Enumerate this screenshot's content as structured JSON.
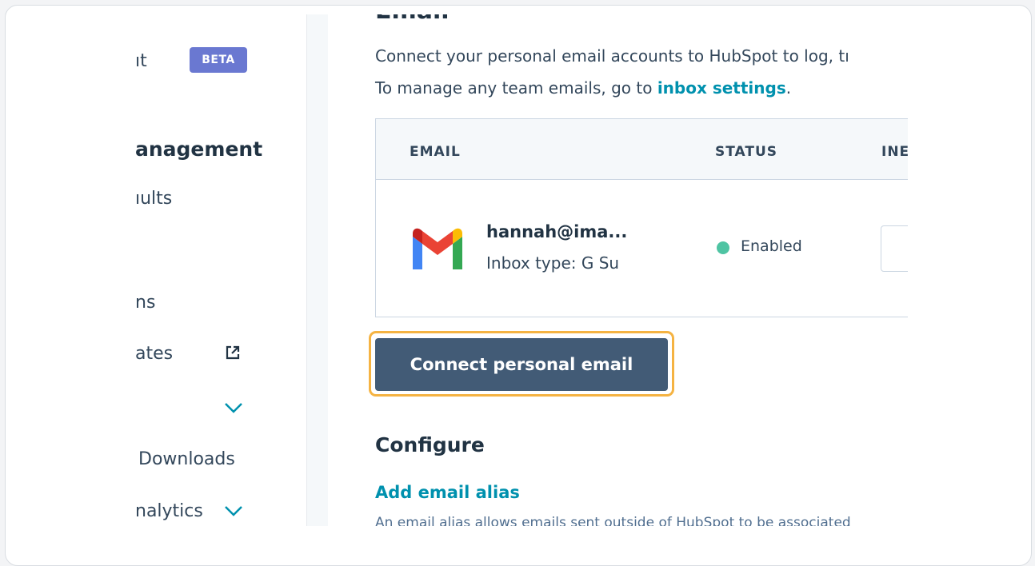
{
  "sidebar": {
    "items": [
      {
        "label": "ıt"
      },
      {
        "label": "anagement"
      },
      {
        "label": "ıults"
      },
      {
        "label": "ns"
      },
      {
        "label": "ates"
      },
      {
        "label": "Downloads"
      },
      {
        "label": "nalytics"
      }
    ],
    "beta_badge": "BETA"
  },
  "main": {
    "heading": "Email",
    "intro_line1": "Connect your personal email accounts to HubSpot to log, tı",
    "intro_line2_prefix": "To manage any team emails, go to ",
    "intro_link": "inbox settings",
    "intro_line2_suffix": ".",
    "table": {
      "columns": [
        "EMAIL",
        "STATUS",
        "INE"
      ],
      "row": {
        "email": "hannah@ima...",
        "inbox_type": "Inbox type: G Su",
        "status": "Enabled"
      }
    },
    "connect_button": "Connect personal email",
    "configure_heading": "Configure",
    "alias_link": "Add email alias",
    "alias_description": "An email alias allows emails sent outside of HubSpot to be associated"
  },
  "colors": {
    "accent": "#0091ae",
    "button": "#425b76",
    "focus_ring": "#f5b342",
    "status_enabled": "#4fc4a3",
    "beta": "#6a78d1"
  },
  "icons": {
    "external_link": "external-link-icon",
    "chevron": "chevron-down-icon",
    "gmail": "gmail-logo-icon"
  }
}
